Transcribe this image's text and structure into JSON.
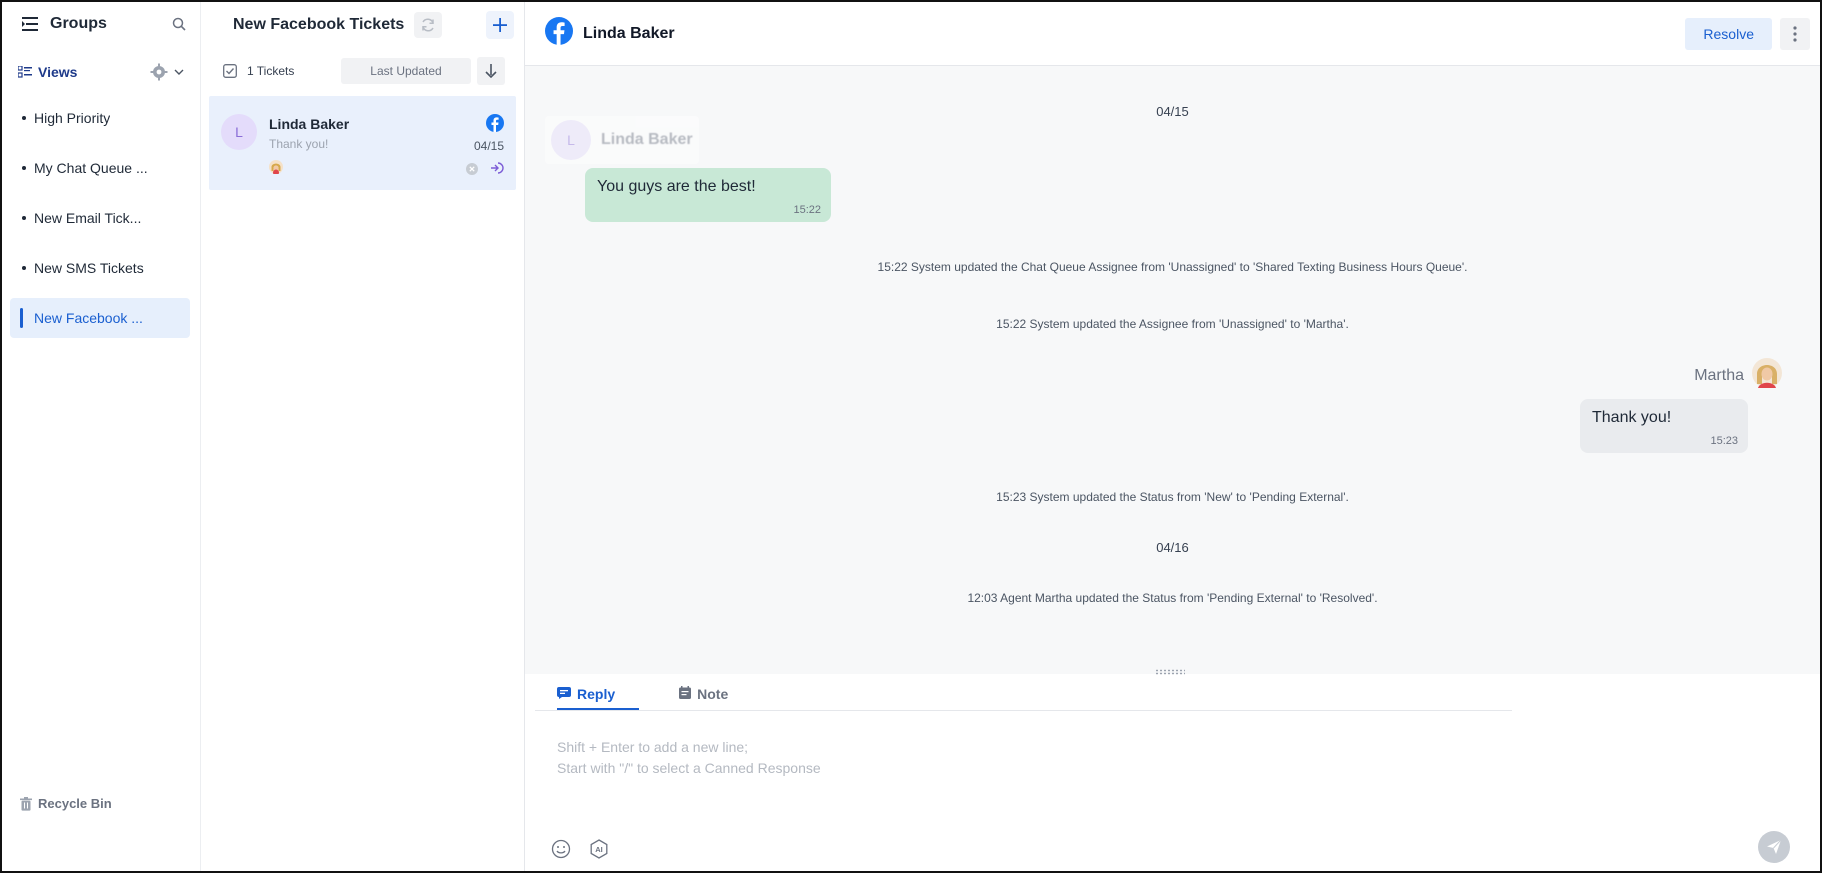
{
  "groups": {
    "title": "Groups",
    "views_label": "Views",
    "items": [
      {
        "label": "High Priority"
      },
      {
        "label": "My Chat Queue ..."
      },
      {
        "label": "New Email Tick..."
      },
      {
        "label": "New SMS Tickets"
      },
      {
        "label": "New Facebook ..."
      }
    ],
    "recycle_label": "Recycle Bin"
  },
  "tickets": {
    "title": "New Facebook Tickets",
    "count_label": "1 Tickets",
    "sort_label": "Last Updated",
    "items": [
      {
        "avatar_letter": "L",
        "name": "Linda Baker",
        "preview": "Thank you!",
        "date": "04/15"
      }
    ]
  },
  "conversation": {
    "contact_name": "Linda Baker",
    "contact_avatar_letter": "L",
    "resolve_label": "Resolve",
    "date_1": "04/15",
    "date_2": "04/16",
    "customer_message": {
      "text": "You guys are the best!",
      "time": "15:22"
    },
    "system_1": "15:22 System updated the Chat Queue Assignee from 'Unassigned' to 'Shared Texting Business Hours Queue'.",
    "system_2": "15:22 System updated the Assignee from 'Unassigned' to 'Martha'.",
    "agent_name": "Martha",
    "agent_message": {
      "text": "Thank you!",
      "time": "15:23"
    },
    "system_3": "15:23 System updated the Status from 'New' to 'Pending External'.",
    "system_4": "12:03 Agent Martha updated the Status from 'Pending External' to 'Resolved'."
  },
  "composer": {
    "tab_reply": "Reply",
    "tab_note": "Note",
    "placeholder": "Shift + Enter to add a new line;\nStart with \"/\" to select a Canned Response"
  },
  "colors": {
    "accent": "#1a5fd0",
    "facebook": "#1877f2",
    "customer_bubble": "#c8e8d6",
    "agent_bubble": "#e9ebee"
  },
  "icons": {
    "menu": "menu-collapse-icon",
    "search": "search-icon",
    "views": "list-view-icon",
    "settings": "gear-icon",
    "chevron": "chevron-down-icon",
    "refresh": "refresh-icon",
    "add": "plus-icon",
    "select_all": "checkbox-icon",
    "sort_direction": "arrow-down-icon",
    "facebook": "facebook-icon",
    "more": "more-vertical-icon",
    "trash": "trash-icon",
    "emoji": "emoji-icon",
    "ai": "ai-icon",
    "send": "send-icon"
  }
}
